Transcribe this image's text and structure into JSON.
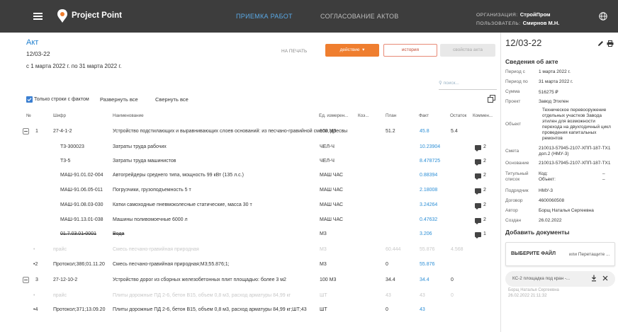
{
  "header": {
    "brand": "Project Point",
    "nav_active": "ПРИЕМКА РАБОТ",
    "nav_other": "СОГЛАСОВАНИЕ АКТОВ",
    "org_label": "ОРГАНИЗАЦИЯ:",
    "org_value": "СтройПром",
    "user_label": "ПОЛЬЗОВАТЕЛЬ:",
    "user_value": "Смирнов М.Н."
  },
  "act": {
    "title": "Акт",
    "number": "12/03-22",
    "period": "с 1 марта 2022 г. по 31 марта 2022 г."
  },
  "toolbar": {
    "print": "НА ПЕЧАТЬ",
    "action": "действие",
    "history": "история",
    "properties": "свойства акта",
    "search_placeholder": "поиск..."
  },
  "filters": {
    "only_fact": "Только строки с фактом",
    "expand_all": "Развернуть все",
    "collapse_all": "Свернуть все"
  },
  "table": {
    "columns": [
      "№",
      "Шифр",
      "Наименование",
      "Ед. измерен...",
      "Коэ...",
      "План",
      "Факт",
      "Остаток",
      "Коммен..."
    ],
    "rows": [
      {
        "kind": "group",
        "toggle": true,
        "n": "1",
        "code": "27-4-1-2",
        "name": "Устройство подстилающих и выравнивающих слоев оснований: из песчано-гравийной смеси, дресвы",
        "unit": "100 М3",
        "plan": "51.2",
        "fact": "45.8",
        "rest": "5.4",
        "comment": ""
      },
      {
        "kind": "sub",
        "code": "Т3-300023",
        "name": "Затраты труда рабочих",
        "unit": "ЧЕЛ-Ч",
        "fact": "10.23904",
        "comment": "2"
      },
      {
        "kind": "sub",
        "code": "Т3-5",
        "name": "Затраты труда машинистов",
        "unit": "ЧЕЛ-Ч",
        "fact": "8.478725",
        "comment": "2"
      },
      {
        "kind": "sub",
        "code": "МАШ-91.01.02-004",
        "name": "Автогрейдеры среднего типа, мощность 99 кВт (135 л.с.)",
        "unit": "МАШ ЧАС",
        "fact": "0.88394",
        "comment": "2"
      },
      {
        "kind": "sub",
        "code": "МАШ-91.06.05-011",
        "name": "Погрузчики, грузоподъемность 5 т",
        "unit": "МАШ ЧАС",
        "fact": "2.18008",
        "comment": "2"
      },
      {
        "kind": "sub",
        "code": "МАШ-91.08.03-030",
        "name": "Катки самоходные пневмоколесные статические, масса 30 т",
        "unit": "МАШ ЧАС",
        "fact": "3.24264",
        "comment": "2"
      },
      {
        "kind": "sub",
        "code": "МАШ-91.13.01-038",
        "name": "Машины поливомоечные 6000 л",
        "unit": "МАШ ЧАС",
        "fact": "0.47632",
        "comment": "2"
      },
      {
        "kind": "struck",
        "code": "01.7.03.01-0001",
        "name": "Вода",
        "unit": "М3",
        "fact": "3.206",
        "comment": "1"
      },
      {
        "kind": "faded",
        "n": "•",
        "code": "прайс",
        "name": "Смесь песчано-гравийная природная",
        "unit": "М3",
        "plan": "60.444",
        "fact": "55.876",
        "rest": "4.568"
      },
      {
        "kind": "plain",
        "n": "•2",
        "code": "Протокол;386;01.11.20",
        "name": "Смесь песчано-гравийная природная;М3;55.876;1;",
        "unit": "М3",
        "plan": "0",
        "fact": "55.876"
      },
      {
        "kind": "group",
        "toggle": true,
        "n": "3",
        "code": "27-12-10-2",
        "name": "Устройство дорог из сборных железобетонных плит площадью: более 3 м2",
        "unit": "100 М3",
        "plan": "34.4",
        "fact": "34.4",
        "rest": "0"
      },
      {
        "kind": "faded",
        "n": "•",
        "code": "прайс",
        "name": "Плиты дорожные ПД 2-6, бетон В15, объем 0,8 м3, расход арматуры 84,99 кг",
        "unit": "ШТ",
        "plan": "43",
        "fact": "43",
        "rest": "0"
      },
      {
        "kind": "plain",
        "n": "•4",
        "code": "Протокол;371;13.09.20",
        "name": "Плиты дорожные ПД 2-6, бетон В15, объем 0,8 м3, расход арматуры 84,99 кг;ШТ;43",
        "unit": "ШТ",
        "plan": "0",
        "fact": "43"
      }
    ]
  },
  "panel": {
    "number": "12/03-22",
    "info_title": "Сведения об акте",
    "fields": [
      {
        "k": "Период с",
        "v": "1 марта 2022 г."
      },
      {
        "k": "Период по",
        "v": "31 марта 2022 г."
      },
      {
        "k": "Сумма",
        "v": "516275 ₽"
      },
      {
        "k": "Проект",
        "v": "Завод Этилен"
      }
    ],
    "object_label": "Объект",
    "object_lines": [
      "Техническое перевооружение",
      "отдельных участков Завода",
      "этилен для возможности",
      "перехода на двухгодичный цикл",
      "проведения капитальных",
      "ремонтов"
    ],
    "estimate_label": "Смета",
    "estimate_lines": [
      "210013-57945-2107-ХПП-187-ТХ1",
      "доп.2 (НМУ-3)"
    ],
    "basis_label": "Основание",
    "basis_value": "210013-57945-2107-ХПП-187-ТХ1",
    "title_list_label_1": "Титульный",
    "title_list_label_2": "список",
    "code_label": "Код:",
    "object_short": "Объект:",
    "dash": "–",
    "contractor_label": "Подрядчик",
    "contractor_value": "НМУ-3",
    "contract_label": "Договор",
    "contract_value": "4600060508",
    "author_label": "Автор",
    "author_value": "Борщ Наталья Сергеевна",
    "created_label": "Создан",
    "created_value": "26.02.2022",
    "add_docs": "Добавить документы",
    "choose_file": "ВЫБЕРИТЕ ФАЙЛ",
    "or_drag": "или Перетащите ...",
    "file_name": "КС-2 площадка под кран -...",
    "file_author": "Борщ Наталья Сергеевна",
    "file_date": "26.02.2022 21:11:32"
  }
}
